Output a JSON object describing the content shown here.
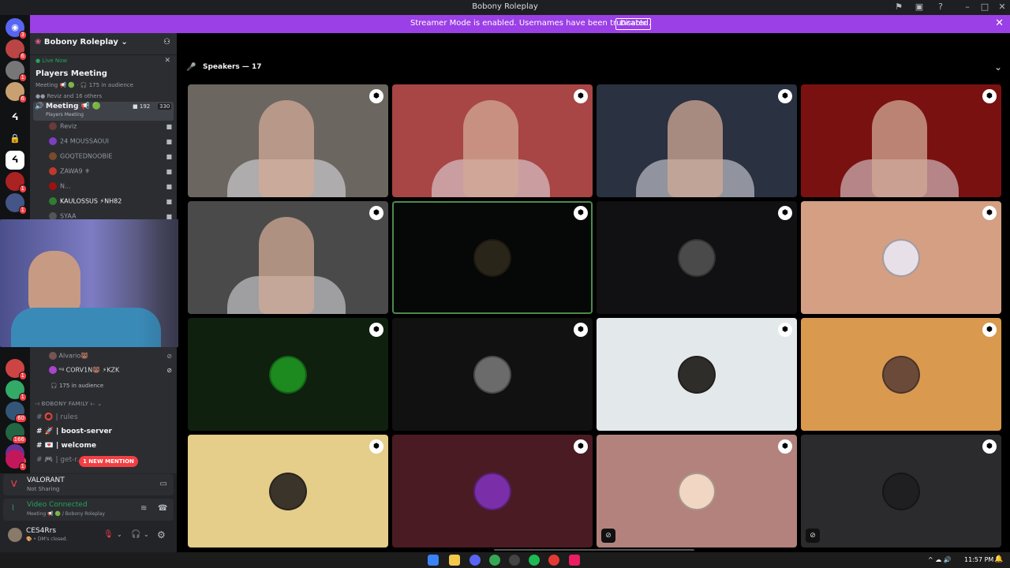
{
  "window": {
    "title": "Bobony Roleplay"
  },
  "banner": {
    "message": "Streamer Mode is enabled. Usernames have been truncated.",
    "button": "Disable"
  },
  "guilds": {
    "badges": [
      "3",
      "6",
      "1",
      "6",
      "1",
      "1",
      "1",
      "1",
      "60",
      "166",
      "1",
      "1"
    ]
  },
  "server": {
    "name": "Bobony Roleplay"
  },
  "live": {
    "label": "Live Now",
    "event_title": "Players Meeting",
    "event_meta": "Meeting 📢 🟢 · 🎧 175 in audience",
    "attendees": "Reviz and 16 others"
  },
  "voice_channel": {
    "name": "Meeting 📢 🟢",
    "subtitle": "Players Meeting",
    "video_count": "192",
    "user_count": "330"
  },
  "voice_users": [
    "Reviz",
    "24 MOUSSAOUI",
    "GOQTEDNOOBIE",
    "ZAWA9 ⚜",
    "N...",
    "KAULOSSUS ⚡NH82",
    "SYAA",
    "Alvario🐻",
    "ᵒᵍ CORV1N🐻 ⚡KZK"
  ],
  "audience": "175 in audience",
  "category": "BOBONY FAMILY",
  "text_channels": [
    {
      "name": "rules",
      "emoji": "⭕"
    },
    {
      "name": "boost-server",
      "emoji": "🚀"
    },
    {
      "name": "welcome",
      "emoji": "💌"
    },
    {
      "name": "get-r...",
      "emoji": "🎮"
    }
  ],
  "mention_badge": "1 NEW MENTION",
  "activity": {
    "game": "VALORANT",
    "status": "Not Sharing"
  },
  "connection": {
    "status": "Video Connected",
    "location": "Meeting 📢 🟢 / Bobony Roleplay"
  },
  "user": {
    "name": "CES4Rrs",
    "status": "🎨 • DM's closed."
  },
  "stage": {
    "header": "Speakers — 17"
  },
  "tiles": [
    {
      "kind": "video",
      "bg": "#6b6660"
    },
    {
      "kind": "video",
      "bg": "#a84545"
    },
    {
      "kind": "video",
      "bg": "#2a3140"
    },
    {
      "kind": "video",
      "bg": "#7a1111"
    },
    {
      "kind": "video",
      "bg": "#4a4a4a"
    },
    {
      "kind": "avatar",
      "bg": "#050806",
      "avatar": "#2a2519",
      "border": "#4c8a4c"
    },
    {
      "kind": "avatar",
      "bg": "#111012",
      "avatar": "#4a4a4a"
    },
    {
      "kind": "avatar",
      "bg": "#d49f82",
      "avatar": "#e8e0e8"
    },
    {
      "kind": "avatar",
      "bg": "#0f200e",
      "avatar": "#1c8a1f"
    },
    {
      "kind": "avatar",
      "bg": "#111111",
      "avatar": "#6b6b6b"
    },
    {
      "kind": "avatar",
      "bg": "#e3e8eb",
      "avatar": "#2f2d2a"
    },
    {
      "kind": "avatar",
      "bg": "#d9994f",
      "avatar": "#6b4a3a"
    },
    {
      "kind": "avatar",
      "bg": "#e5cd8a",
      "avatar": "#3a342a"
    },
    {
      "kind": "avatar",
      "bg": "#4a1b22",
      "avatar": "#7a2ea8"
    },
    {
      "kind": "avatar",
      "bg": "#b3827d",
      "avatar": "#f1d6c4",
      "muted": true
    },
    {
      "kind": "avatar",
      "bg": "#2b2b2d",
      "avatar": "#1f1f22",
      "muted": true
    }
  ],
  "taskbar": {
    "time": "11:57 PM"
  }
}
